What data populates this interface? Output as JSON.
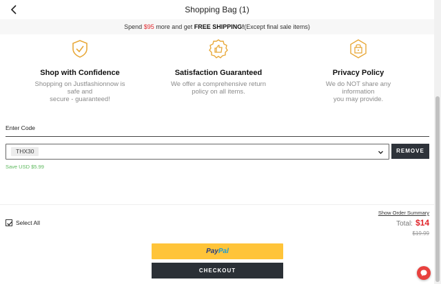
{
  "header": {
    "title": "Shopping Bag (1)"
  },
  "promo": {
    "prefix": "Spend ",
    "amount": "$95",
    "middle": " more and get ",
    "highlight": "FREE SHIPPING!",
    "suffix": "(Except final sale items)"
  },
  "features": [
    {
      "icon": "shield-check-icon",
      "title": "Shop with Confidence",
      "line1": "Shopping on Justfashionnow is safe and",
      "line2": "secure - guaranteed!"
    },
    {
      "icon": "thumbs-up-badge-icon",
      "title": "Satisfaction Guaranteed",
      "line1": "We offer a comprehensive return",
      "line2": "policy on all items."
    },
    {
      "icon": "lock-badge-icon",
      "title": "Privacy Policy",
      "line1": "We do NOT share any information",
      "line2": "you may provide."
    }
  ],
  "coupon": {
    "label": "Enter Code",
    "value": "THX30",
    "remove_label": "REMOVE",
    "savings": "Save USD $5.99"
  },
  "summary": {
    "show_summary_label": "Show Order Summary",
    "select_all_label": "Select All",
    "select_all_checked": true,
    "total_label": "Total:",
    "total_value": "$14",
    "original_price": "$19.99"
  },
  "actions": {
    "paypal_pay": "Pay",
    "paypal_pal": "Pal",
    "checkout_label": "CHECKOUT"
  },
  "colors": {
    "accent_red": "#e0262c",
    "gold_icon": "#e8a838",
    "savings_green": "#5cb85c",
    "dark_button": "#2e333a",
    "paypal_yellow": "#ffc439"
  }
}
